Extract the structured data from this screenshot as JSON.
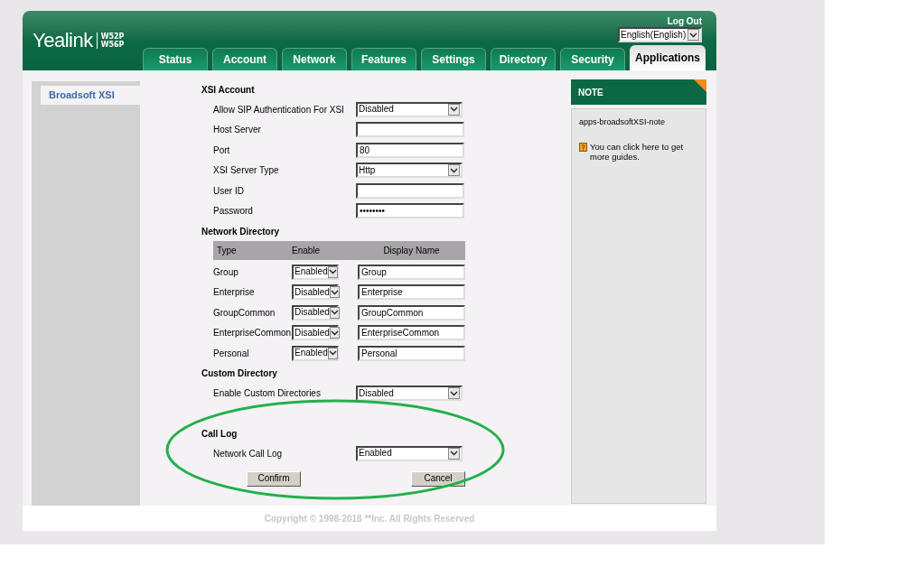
{
  "header": {
    "brand": "Yealink",
    "models": [
      "W52P",
      "W56P"
    ],
    "logout": "Log Out",
    "language": "English(English)"
  },
  "tabs": [
    {
      "label": "Status",
      "selected": false
    },
    {
      "label": "Account",
      "selected": false
    },
    {
      "label": "Network",
      "selected": false
    },
    {
      "label": "Features",
      "selected": false
    },
    {
      "label": "Settings",
      "selected": false
    },
    {
      "label": "Directory",
      "selected": false
    },
    {
      "label": "Security",
      "selected": false
    },
    {
      "label": "Applications",
      "selected": true
    }
  ],
  "sidebar": {
    "items": [
      {
        "label": "Broadsoft XSI",
        "selected": true
      }
    ]
  },
  "xsi_account": {
    "heading": "XSI Account",
    "fields": [
      {
        "label": "Allow SIP Authentication For XSI",
        "kind": "select",
        "value": "Disabled"
      },
      {
        "label": "Host Server",
        "kind": "text"
      },
      {
        "label": "Port",
        "kind": "text",
        "value": "80"
      },
      {
        "label": "XSI Server Type",
        "kind": "select",
        "value": "Http"
      },
      {
        "label": "User ID",
        "kind": "text"
      },
      {
        "label": "Password",
        "kind": "text",
        "value": "••••••••"
      }
    ]
  },
  "network_directory": {
    "heading": "Network Directory",
    "columns": [
      "Type",
      "Enable",
      "Display Name"
    ],
    "rows": [
      {
        "type": "Group",
        "enable": "Enabled",
        "display_name": "Group"
      },
      {
        "type": "Enterprise",
        "enable": "Disabled",
        "display_name": "Enterprise"
      },
      {
        "type": "GroupCommon",
        "enable": "Disabled",
        "display_name": "GroupCommon"
      },
      {
        "type": "EnterpriseCommon",
        "enable": "Disabled",
        "display_name": "EnterpriseCommon"
      },
      {
        "type": "Personal",
        "enable": "Enabled",
        "display_name": "Personal"
      }
    ]
  },
  "custom_directory": {
    "heading": "Custom Directory",
    "fields": [
      {
        "label": "Enable Custom Directories",
        "kind": "select",
        "value": "Disabled"
      }
    ]
  },
  "call_log": {
    "heading": "Call Log",
    "fields": [
      {
        "label": "Network Call Log",
        "kind": "select",
        "value": "Enabled"
      }
    ]
  },
  "buttons": {
    "confirm": "Confirm",
    "cancel": "Cancel"
  },
  "note": {
    "title": "NOTE",
    "key": "apps-broadsoftXSI-note",
    "help": "You can click here to get more guides."
  },
  "footer": "Copyright © 1998-2018 **Inc. All Rights Reserved"
}
